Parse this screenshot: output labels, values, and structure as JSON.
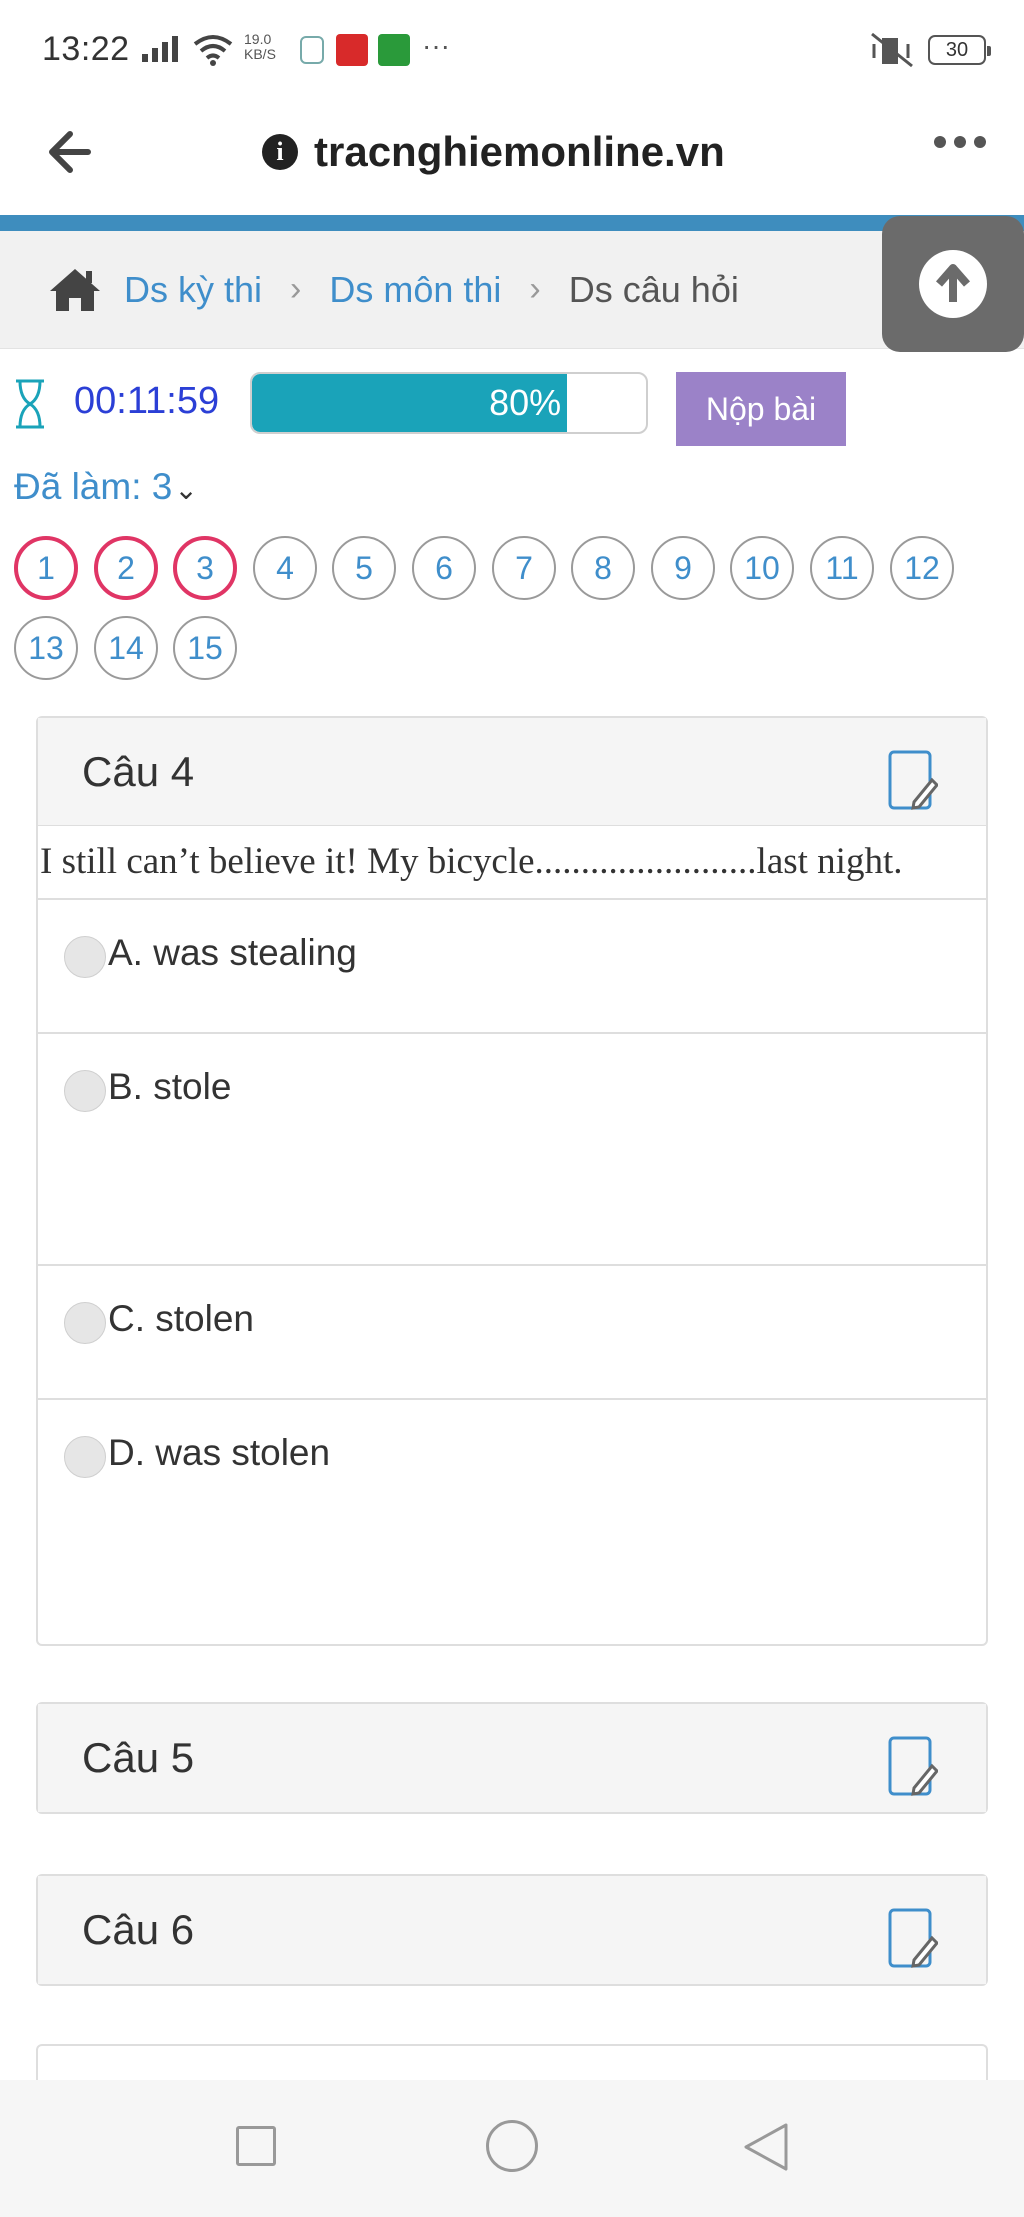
{
  "status_bar": {
    "time": "13:22",
    "net_speed": "19.0 KB/S",
    "battery": "30",
    "overflow": "···"
  },
  "browser": {
    "url": "tracnghiemonline.vn",
    "info_icon": "i"
  },
  "breadcrumb": {
    "items": [
      "Ds kỳ thi",
      "Ds môn thi",
      "Ds câu hỏi"
    ],
    "separator": "›"
  },
  "quiz": {
    "timer": "00:11:59",
    "progress": 80,
    "progress_label": "80%",
    "submit_label": "Nộp bài",
    "done_label": "Đã làm: 3",
    "question_numbers": [
      "1",
      "2",
      "3",
      "4",
      "5",
      "6",
      "7",
      "8",
      "9",
      "10",
      "11",
      "12",
      "13",
      "14",
      "15"
    ],
    "answered_count": 3
  },
  "questions": [
    {
      "title": "Câu 4",
      "text": "I still can’t believe it! My bicycle........................last night.",
      "options": [
        "A. was stealing",
        "B. stole",
        "C. stolen",
        "D. was stolen"
      ]
    },
    {
      "title": "Câu 5"
    },
    {
      "title": "Câu 6"
    }
  ],
  "colors": {
    "accent_blue": "#3f8ecb",
    "progress_teal": "#1aa3b9",
    "submit_purple": "#9b82c8",
    "answered_pink": "#e03565",
    "timer_blue": "#2b3fd6"
  }
}
